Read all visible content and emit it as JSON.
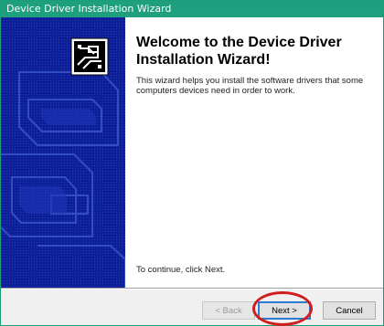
{
  "window": {
    "title": "Device Driver Installation Wizard"
  },
  "content": {
    "heading": "Welcome to the Device Driver Installation Wizard!",
    "description": "This wizard helps you install the software drivers that some computers devices need in order to work.",
    "continue_text": "To continue, click Next."
  },
  "buttons": {
    "back_label": "< Back",
    "next_label": "Next >",
    "cancel_label": "Cancel"
  },
  "colors": {
    "title_bar": "#1ea07e",
    "side_panel": "#0c1f99",
    "highlight": "#d21c1c"
  }
}
